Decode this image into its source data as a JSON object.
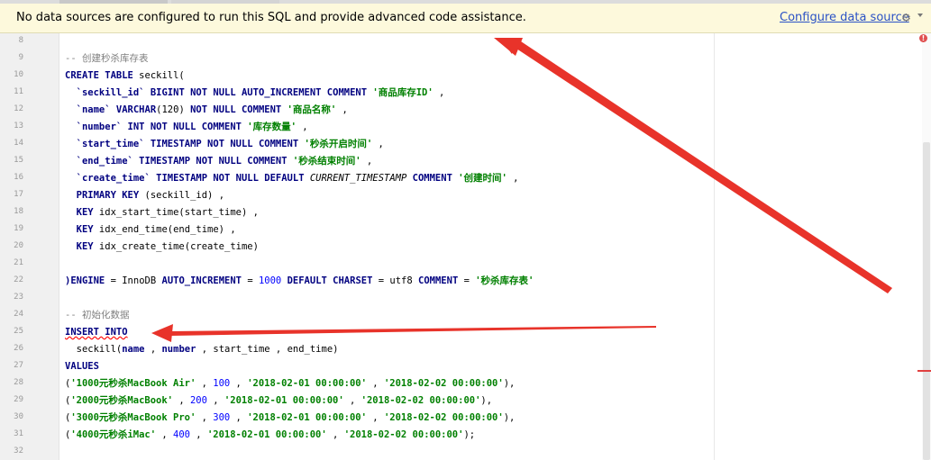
{
  "banner": {
    "message": "No data sources are configured to run this SQL and provide advanced code assistance.",
    "link": "Configure data source",
    "gear_icon": "gear-icon"
  },
  "line_numbers": [
    "8",
    "9",
    "10",
    "11",
    "12",
    "13",
    "14",
    "15",
    "16",
    "17",
    "18",
    "19",
    "20",
    "21",
    "22",
    "23",
    "24",
    "25",
    "26",
    "27",
    "28",
    "29",
    "30",
    "31",
    "32"
  ],
  "code": {
    "l9": "-- 创建秒杀库存表",
    "l10_kw": "CREATE TABLE",
    "l10_rest": " seckill(",
    "l11_col": "  `seckill_id`",
    "l11_kw": " BIGINT NOT NULL AUTO_INCREMENT COMMENT",
    "l11_str": " '商品库存ID'",
    "l11_tail": " ,",
    "l12_col": "  `name`",
    "l12_kw": " VARCHAR",
    "l12_mid": "(120)",
    "l12_kw2": " NOT NULL COMMENT",
    "l12_str": " '商品名称'",
    "l12_tail": " ,",
    "l13_col": "  `number`",
    "l13_kw": " INT NOT NULL COMMENT",
    "l13_str": " '库存数量'",
    "l13_tail": " ,",
    "l14_col": "  `start_time`",
    "l14_kw": " TIMESTAMP NOT NULL COMMENT",
    "l14_str": " '秒杀开启时间'",
    "l14_tail": " ,",
    "l15_col": "  `end_time`",
    "l15_kw": " TIMESTAMP NOT NULL COMMENT",
    "l15_str": " '秒杀结束时间'",
    "l15_tail": " ,",
    "l16_col": "  `create_time`",
    "l16_kw": " TIMESTAMP NOT NULL DEFAULT",
    "l16_it": " CURRENT_TIMESTAMP",
    "l16_kw2": " COMMENT",
    "l16_str": " '创建时间'",
    "l16_tail": " ,",
    "l17_kw": "  PRIMARY KEY",
    "l17_rest": " (seckill_id) ,",
    "l18_kw": "  KEY",
    "l18_rest": " idx_start_time(start_time) ,",
    "l19_kw": "  KEY",
    "l19_rest": " idx_end_time(end_time) ,",
    "l20_kw": "  KEY",
    "l20_rest": " idx_create_time(create_time)",
    "l22_a": ")ENGINE",
    "l22_b": " = InnoDB",
    "l22_kw": " AUTO_INCREMENT",
    "l22_c": " = ",
    "l22_num": "1000",
    "l22_kw2": " DEFAULT CHARSET",
    "l22_d": " = utf8",
    "l22_kw3": " COMMENT",
    "l22_e": " = ",
    "l22_str": "'秒杀库存表'",
    "l24": "-- 初始化数据",
    "l25_kw": "INSERT INTO",
    "l26_a": "  seckill(",
    "l26_kw": "name",
    "l26_b": " , ",
    "l26_kw2": "number",
    "l26_c": " , start_time , end_time)",
    "l27_kw": "VALUES",
    "l28_a": "(",
    "l28_s1": "'1000元秒杀MacBook Air'",
    "l28_b": " , ",
    "l28_n": "100",
    "l28_c": " , ",
    "l28_s2": "'2018-02-01 00:00:00'",
    "l28_d": " , ",
    "l28_s3": "'2018-02-02 00:00:00'",
    "l28_e": "),",
    "l29_a": "(",
    "l29_s1": "'2000元秒杀MacBook'",
    "l29_b": " , ",
    "l29_n": "200",
    "l29_c": " , ",
    "l29_s2": "'2018-02-01 00:00:00'",
    "l29_d": " , ",
    "l29_s3": "'2018-02-02 00:00:00'",
    "l29_e": "),",
    "l30_a": "(",
    "l30_s1": "'3000元秒杀MacBook Pro'",
    "l30_b": " , ",
    "l30_n": "300",
    "l30_c": " , ",
    "l30_s2": "'2018-02-01 00:00:00'",
    "l30_d": " , ",
    "l30_s3": "'2018-02-02 00:00:00'",
    "l30_e": "),",
    "l31_a": "(",
    "l31_s1": "'4000元秒杀iMac'",
    "l31_b": " , ",
    "l31_n": "400",
    "l31_c": " , ",
    "l31_s2": "'2018-02-01 00:00:00'",
    "l31_d": " , ",
    "l31_s3": "'2018-02-02 00:00:00'",
    "l31_e": ");"
  },
  "colors": {
    "keyword": "#000080",
    "string": "#008000",
    "number": "#0000ff",
    "comment": "#808080",
    "annotation_arrow": "#e8332a",
    "banner_bg": "#fdf9dc"
  },
  "icons": {
    "banner_settings": "gear-icon",
    "error_marker": "error-icon",
    "annotation": "arrow-icon"
  }
}
